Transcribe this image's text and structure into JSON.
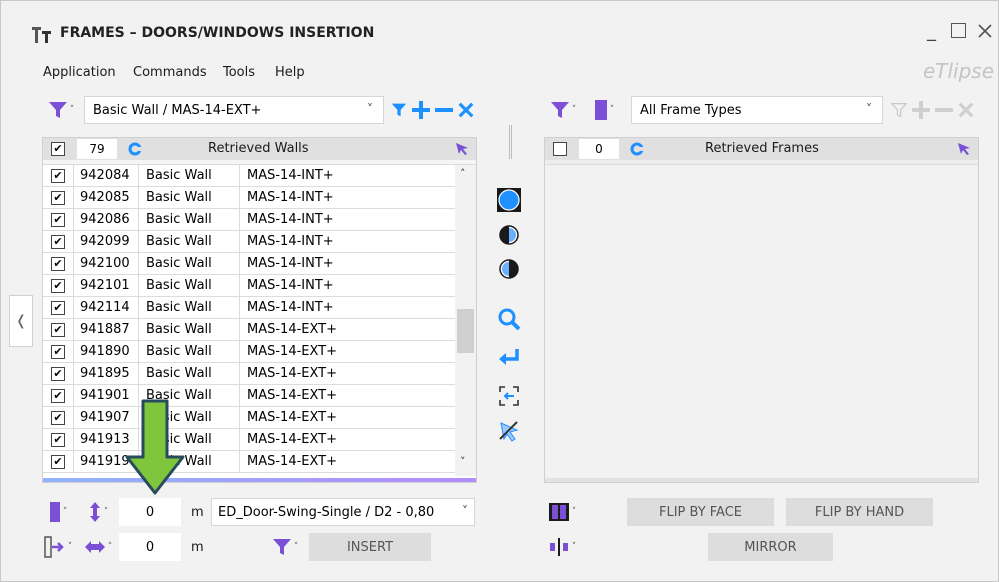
{
  "window": {
    "title": "FRAMES – DOORS/WINDOWS INSERTION",
    "brand": "eTlipse"
  },
  "menu": [
    "Application",
    "Commands",
    "Tools",
    "Help"
  ],
  "left": {
    "wall_type": "Basic Wall / MAS-14-EXT+",
    "count": "79",
    "header": "Retrieved Walls",
    "rows": [
      {
        "id": "942084",
        "family": "Basic Wall",
        "type": "MAS-14-INT+"
      },
      {
        "id": "942085",
        "family": "Basic Wall",
        "type": "MAS-14-INT+"
      },
      {
        "id": "942086",
        "family": "Basic Wall",
        "type": "MAS-14-INT+"
      },
      {
        "id": "942099",
        "family": "Basic Wall",
        "type": "MAS-14-INT+"
      },
      {
        "id": "942100",
        "family": "Basic Wall",
        "type": "MAS-14-INT+"
      },
      {
        "id": "942101",
        "family": "Basic Wall",
        "type": "MAS-14-INT+"
      },
      {
        "id": "942114",
        "family": "Basic Wall",
        "type": "MAS-14-INT+"
      },
      {
        "id": "941887",
        "family": "Basic Wall",
        "type": "MAS-14-EXT+"
      },
      {
        "id": "941890",
        "family": "Basic Wall",
        "type": "MAS-14-EXT+"
      },
      {
        "id": "941895",
        "family": "Basic Wall",
        "type": "MAS-14-EXT+"
      },
      {
        "id": "941901",
        "family": "Basic Wall",
        "type": "MAS-14-EXT+"
      },
      {
        "id": "941907",
        "family": "Basic Wall",
        "type": "MAS-14-EXT+"
      },
      {
        "id": "941913",
        "family": "Basic Wall",
        "type": "MAS-14-EXT+"
      },
      {
        "id": "941919",
        "family": "Basic Wall",
        "type": "MAS-14-EXT+"
      }
    ]
  },
  "right": {
    "frame_type": "All Frame Types",
    "count": "0",
    "header": "Retrieved Frames"
  },
  "bottom": {
    "height_value": "0",
    "height_unit": "m",
    "offset_value": "0",
    "offset_unit": "m",
    "door_type": "ED_Door-Swing-Single / D2 - 0,80",
    "insert_label": "INSERT",
    "flip_face_label": "FLIP BY FACE",
    "flip_hand_label": "FLIP BY HAND",
    "mirror_label": "MIRROR"
  },
  "colors": {
    "accent_blue": "#1e90ff",
    "purple": "#7b4fd6",
    "arrow_green": "#7fc63c",
    "arrow_outline": "#2a4a5e"
  }
}
